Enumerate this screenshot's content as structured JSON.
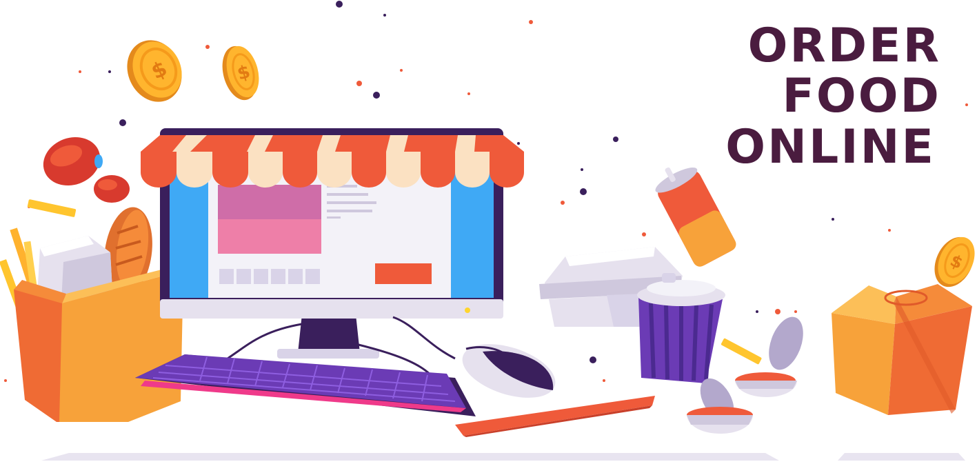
{
  "headline": {
    "line1": "ORDER FOOD",
    "line2": "ONLINE"
  },
  "colors": {
    "headline": "#4a1c3f",
    "awning_red": "#ef5a3a",
    "awning_cream": "#fbe1c2",
    "monitor_frame": "#3a1f5c",
    "screen_blue": "#3fa9f5",
    "screen_pink": "#ee7fa8",
    "keyboard_purple": "#6b3bb5",
    "orange": "#f7a23a",
    "coin_gold": "#ffb52e",
    "lavender": "#d9d3e8"
  },
  "icons": [
    "coin-icon",
    "tomato-icon",
    "bread-icon",
    "milk-carton-icon",
    "fries-icon",
    "paper-bag-icon",
    "monitor-icon",
    "awning-icon",
    "keyboard-icon",
    "mouse-icon",
    "soda-can-icon",
    "food-container-icon",
    "drink-cup-icon",
    "sauce-cup-icon",
    "takeout-box-icon"
  ]
}
